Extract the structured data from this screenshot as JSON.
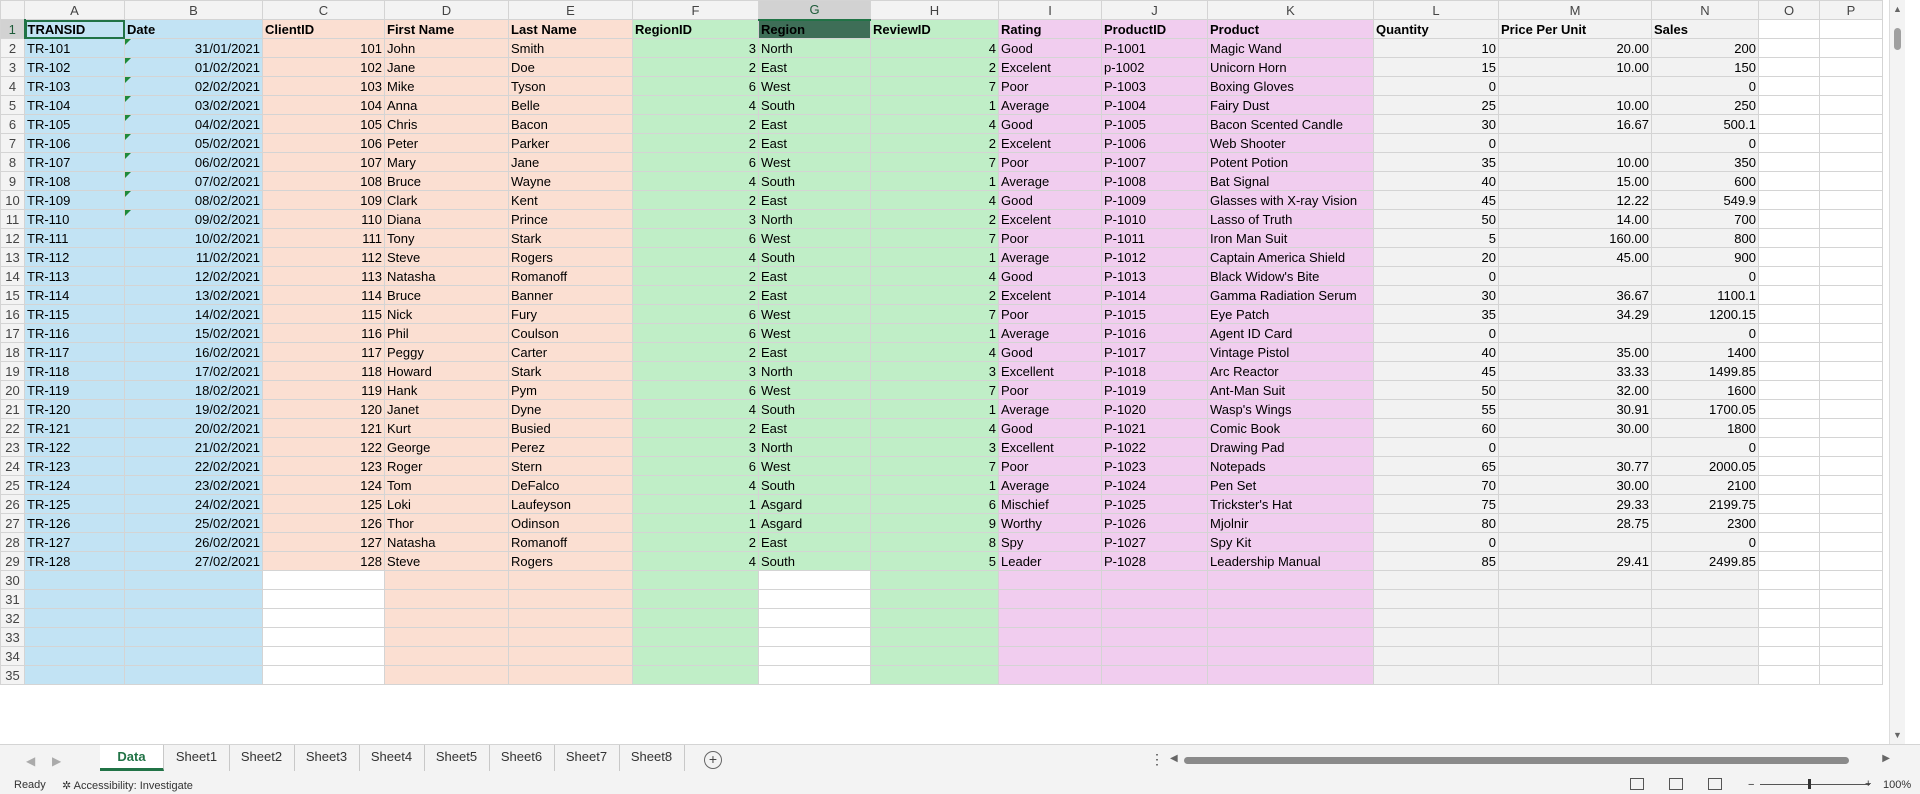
{
  "columns": [
    "A",
    "B",
    "C",
    "D",
    "E",
    "F",
    "G",
    "H",
    "I",
    "J",
    "K",
    "L",
    "M",
    "N",
    "O",
    "P"
  ],
  "selected_column": "G",
  "selected_row": 1,
  "headers": [
    "TRANSID",
    "Date",
    "ClientID",
    "First Name",
    "Last Name",
    "RegionID",
    "Region",
    "ReviewID",
    "Rating",
    "ProductID",
    "Product",
    "Quantity",
    "Price Per Unit",
    "Sales",
    "",
    ""
  ],
  "rows": [
    [
      "TR-101",
      "31/01/2021",
      "101",
      "John",
      "Smith",
      "3",
      "North",
      "4",
      "Good",
      "P-1001",
      "Magic Wand",
      "10",
      "20.00",
      "200"
    ],
    [
      "TR-102",
      "01/02/2021",
      "102",
      "Jane",
      "Doe",
      "2",
      "East",
      "2",
      "Excelent",
      "p-1002",
      "Unicorn Horn",
      "15",
      "10.00",
      "150"
    ],
    [
      "TR-103",
      "02/02/2021",
      "103",
      "Mike",
      "Tyson",
      "6",
      "West",
      "7",
      "Poor",
      "P-1003",
      "Boxing Gloves",
      "0",
      "",
      "0"
    ],
    [
      "TR-104",
      "03/02/2021",
      "104",
      "Anna",
      "Belle",
      "4",
      "South",
      "1",
      "Average",
      "P-1004",
      "Fairy Dust",
      "25",
      "10.00",
      "250"
    ],
    [
      "TR-105",
      "04/02/2021",
      "105",
      "Chris",
      "Bacon",
      "2",
      "East",
      "4",
      "Good",
      "P-1005",
      "Bacon Scented Candle",
      "30",
      "16.67",
      "500.1"
    ],
    [
      "TR-106",
      "05/02/2021",
      "106",
      "Peter",
      "Parker",
      "2",
      "East",
      "2",
      "Excelent",
      "P-1006",
      "Web Shooter",
      "0",
      "",
      "0"
    ],
    [
      "TR-107",
      "06/02/2021",
      "107",
      "Mary",
      "Jane",
      "6",
      "West",
      "7",
      "Poor",
      "P-1007",
      "Potent Potion",
      "35",
      "10.00",
      "350"
    ],
    [
      "TR-108",
      "07/02/2021",
      "108",
      "Bruce",
      "Wayne",
      "4",
      "South",
      "1",
      "Average",
      "P-1008",
      "Bat Signal",
      "40",
      "15.00",
      "600"
    ],
    [
      "TR-109",
      "08/02/2021",
      "109",
      "Clark",
      "Kent",
      "2",
      "East",
      "4",
      "Good",
      "P-1009",
      "Glasses with X-ray Vision",
      "45",
      "12.22",
      "549.9"
    ],
    [
      "TR-110",
      "09/02/2021",
      "110",
      "Diana",
      "Prince",
      "3",
      "North",
      "2",
      "Excelent",
      "P-1010",
      "Lasso of Truth",
      "50",
      "14.00",
      "700"
    ],
    [
      "TR-111",
      "10/02/2021",
      "111",
      "Tony",
      "Stark",
      "6",
      "West",
      "7",
      "Poor",
      "P-1011",
      "Iron Man Suit",
      "5",
      "160.00",
      "800"
    ],
    [
      "TR-112",
      "11/02/2021",
      "112",
      "Steve",
      "Rogers",
      "4",
      "South",
      "1",
      "Average",
      "P-1012",
      "Captain America Shield",
      "20",
      "45.00",
      "900"
    ],
    [
      "TR-113",
      "12/02/2021",
      "113",
      "Natasha",
      "Romanoff",
      "2",
      "East",
      "4",
      "Good",
      "P-1013",
      "Black Widow's Bite",
      "0",
      "",
      "0"
    ],
    [
      "TR-114",
      "13/02/2021",
      "114",
      "Bruce",
      "Banner",
      "2",
      "East",
      "2",
      "Excelent",
      "P-1014",
      "Gamma Radiation Serum",
      "30",
      "36.67",
      "1100.1"
    ],
    [
      "TR-115",
      "14/02/2021",
      "115",
      "Nick",
      "Fury",
      "6",
      "West",
      "7",
      "Poor",
      "P-1015",
      "Eye Patch",
      "35",
      "34.29",
      "1200.15"
    ],
    [
      "TR-116",
      "15/02/2021",
      "116",
      "Phil",
      "Coulson",
      "6",
      "West",
      "1",
      "Average",
      "P-1016",
      "Agent ID Card",
      "0",
      "",
      "0"
    ],
    [
      "TR-117",
      "16/02/2021",
      "117",
      "Peggy",
      "Carter",
      "2",
      "East",
      "4",
      "Good",
      "P-1017",
      "Vintage Pistol",
      "40",
      "35.00",
      "1400"
    ],
    [
      "TR-118",
      "17/02/2021",
      "118",
      "Howard",
      "Stark",
      "3",
      "North",
      "3",
      "Excellent",
      "P-1018",
      "Arc Reactor",
      "45",
      "33.33",
      "1499.85"
    ],
    [
      "TR-119",
      "18/02/2021",
      "119",
      "Hank",
      "Pym",
      "6",
      "West",
      "7",
      "Poor",
      "P-1019",
      "Ant-Man Suit",
      "50",
      "32.00",
      "1600"
    ],
    [
      "TR-120",
      "19/02/2021",
      "120",
      "Janet",
      "Dyne",
      "4",
      "South",
      "1",
      "Average",
      "P-1020",
      "Wasp's Wings",
      "55",
      "30.91",
      "1700.05"
    ],
    [
      "TR-121",
      "20/02/2021",
      "121",
      "Kurt",
      "Busied",
      "2",
      "East",
      "4",
      "Good",
      "P-1021",
      "Comic Book",
      "60",
      "30.00",
      "1800"
    ],
    [
      "TR-122",
      "21/02/2021",
      "122",
      "George",
      "Perez",
      "3",
      "North",
      "3",
      "Excellent",
      "P-1022",
      "Drawing Pad",
      "0",
      "",
      "0"
    ],
    [
      "TR-123",
      "22/02/2021",
      "123",
      "Roger",
      "Stern",
      "6",
      "West",
      "7",
      "Poor",
      "P-1023",
      "Notepads",
      "65",
      "30.77",
      "2000.05"
    ],
    [
      "TR-124",
      "23/02/2021",
      "124",
      "Tom",
      "DeFalco",
      "4",
      "South",
      "1",
      "Average",
      "P-1024",
      "Pen Set",
      "70",
      "30.00",
      "2100"
    ],
    [
      "TR-125",
      "24/02/2021",
      "125",
      "Loki",
      "Laufeyson",
      "1",
      "Asgard",
      "6",
      "Mischief",
      "P-1025",
      "Trickster's Hat",
      "75",
      "29.33",
      "2199.75"
    ],
    [
      "TR-126",
      "25/02/2021",
      "126",
      "Thor",
      "Odinson",
      "1",
      "Asgard",
      "9",
      "Worthy",
      "P-1026",
      "Mjolnir",
      "80",
      "28.75",
      "2300"
    ],
    [
      "TR-127",
      "26/02/2021",
      "127",
      "Natasha",
      "Romanoff",
      "2",
      "East",
      "8",
      "Spy",
      "P-1027",
      "Spy Kit",
      "0",
      "",
      "0"
    ],
    [
      "TR-128",
      "27/02/2021",
      "128",
      "Steve",
      "Rogers",
      "4",
      "South",
      "5",
      "Leader",
      "P-1028",
      "Leadership Manual",
      "85",
      "29.41",
      "2499.85"
    ]
  ],
  "empty_row_numbers": [
    "30",
    "31",
    "32",
    "33",
    "34",
    "35"
  ],
  "sheet_tabs": [
    "Data",
    "Sheet1",
    "Sheet2",
    "Sheet3",
    "Sheet4",
    "Sheet5",
    "Sheet6",
    "Sheet7",
    "Sheet8"
  ],
  "active_tab": "Data",
  "status": {
    "ready": "Ready",
    "accessibility": "Accessibility: Investigate",
    "zoom": "100%",
    "zoom_minus": "−",
    "zoom_plus": "+"
  },
  "icons": {
    "add_sheet": "plus-circle-icon",
    "tab_menu": "vertical-ellipsis-icon",
    "accessibility": "accessibility-icon"
  },
  "colors": {
    "accent": "#217346",
    "blue_fill": "#c2e3f4",
    "peach_fill": "#fbdfd2",
    "green_fill": "#c0eec7",
    "pink_fill": "#f1cdef",
    "grey_fill": "#f2f2f2",
    "selected_header": "#3e6e57"
  }
}
